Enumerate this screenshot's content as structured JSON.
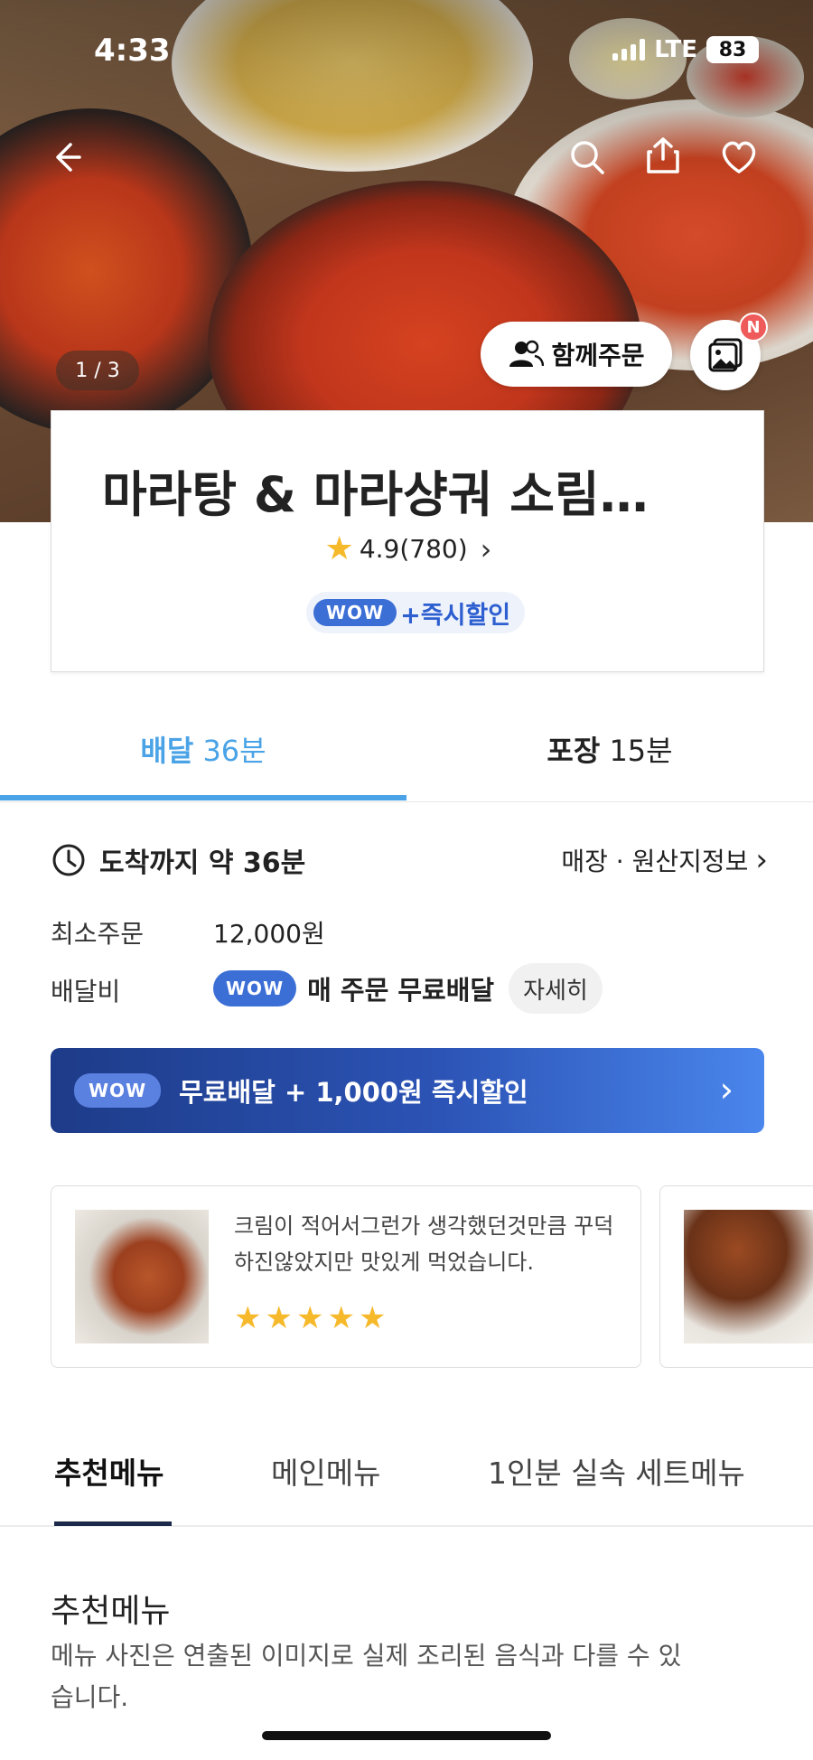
{
  "status_bar": {
    "time": "4:33",
    "network": "LTE",
    "battery": "83"
  },
  "hero": {
    "pager": "1 / 3",
    "group_order_label": "함께주문",
    "photo_badge": "N"
  },
  "store": {
    "name": "마라탕 & 마라샹궈 소림…",
    "rating": "4.9(780)",
    "wow_tag": "WOW",
    "wow_text": "+즉시할인"
  },
  "delivery_tabs": [
    {
      "bold": "배달",
      "time": "36분"
    },
    {
      "bold": "포장",
      "time": "15분"
    }
  ],
  "info": {
    "arrive_text": "도착까지 약 36분",
    "store_info_link": "매장 · 원산지정보",
    "min_order_label": "최소주문",
    "min_order_value": "12,000원",
    "fee_label": "배달비",
    "fee_wow_tag": "WOW",
    "fee_text": "매 주문 무료배달",
    "detail_button": "자세히"
  },
  "promo": {
    "wow_tag": "WOW",
    "text": "무료배달 + 1,000원 즉시할인"
  },
  "reviews": [
    {
      "text": "크림이 적어서그런가 생각했던것만큼 꾸덕하진않았지만 맛있게 먹었습니다.",
      "stars": [
        "★",
        "★",
        "★",
        "★",
        "★"
      ]
    }
  ],
  "menu_tabs": [
    "추천메뉴",
    "메인메뉴",
    "1인분 실속 세트메뉴"
  ],
  "section": {
    "title": "추천메뉴",
    "description": "메뉴 사진은 연출된 이미지로 실제 조리된 음식과 다를 수 있습니다."
  },
  "colors": {
    "accent": "#4aa3e6",
    "wow_blue": "#3c6fd6",
    "star": "#f6b92b",
    "promo_dark": "#1d3b88"
  }
}
